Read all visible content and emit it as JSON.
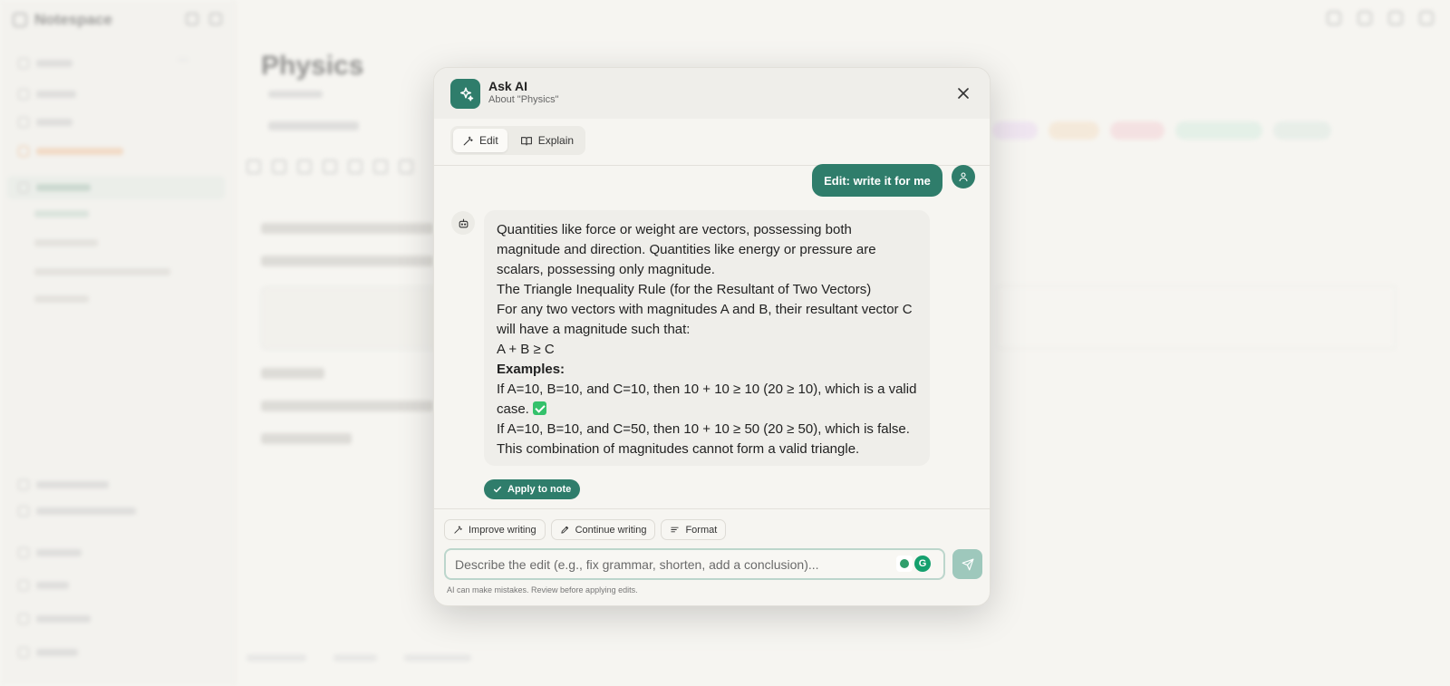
{
  "modal": {
    "title": "Ask AI",
    "subtitle": "About \"Physics\"",
    "tabs": [
      {
        "label": "Edit",
        "icon": "wand-icon",
        "active": true
      },
      {
        "label": "Explain",
        "icon": "book-icon",
        "active": false
      }
    ],
    "user_message": "Edit: write it for me",
    "ai_response": {
      "lines": [
        "Quantities like force or weight are vectors, possessing both magnitude and direction. Quantities like energy or pressure are scalars, possessing only magnitude.",
        "The Triangle Inequality Rule (for the Resultant of Two Vectors)",
        "For any two vectors with magnitudes A and B, their resultant vector C will have a magnitude such that:",
        "A + B ≥ C",
        "Examples:",
        "If A=10, B=10, and C=10, then 10 + 10 ≥ 10 (20 ≥ 10), which is a valid case.",
        "If A=10, B=10, and C=50, then 10 + 10 ≥ 50 (20 ≥ 50), which is false. This combination of magnitudes cannot form a valid triangle."
      ]
    },
    "apply_label": "Apply to note",
    "quick_actions": [
      {
        "label": "Improve writing",
        "icon": "wand-icon"
      },
      {
        "label": "Continue writing",
        "icon": "pencil-icon"
      },
      {
        "label": "Format",
        "icon": "list-icon"
      }
    ],
    "input_placeholder": "Describe the edit (e.g., fix grammar, shorten, add a conclusion)...",
    "disclaimer": "AI can make mistakes. Review before applying edits."
  },
  "background": {
    "workspace": "Notespace",
    "doc_title": "Physics"
  },
  "colors": {
    "accent": "#2f7d6b",
    "accent_light": "#9ec8bc",
    "modal_bg": "#f6f5f1",
    "bubble_bg": "#efeeea"
  }
}
